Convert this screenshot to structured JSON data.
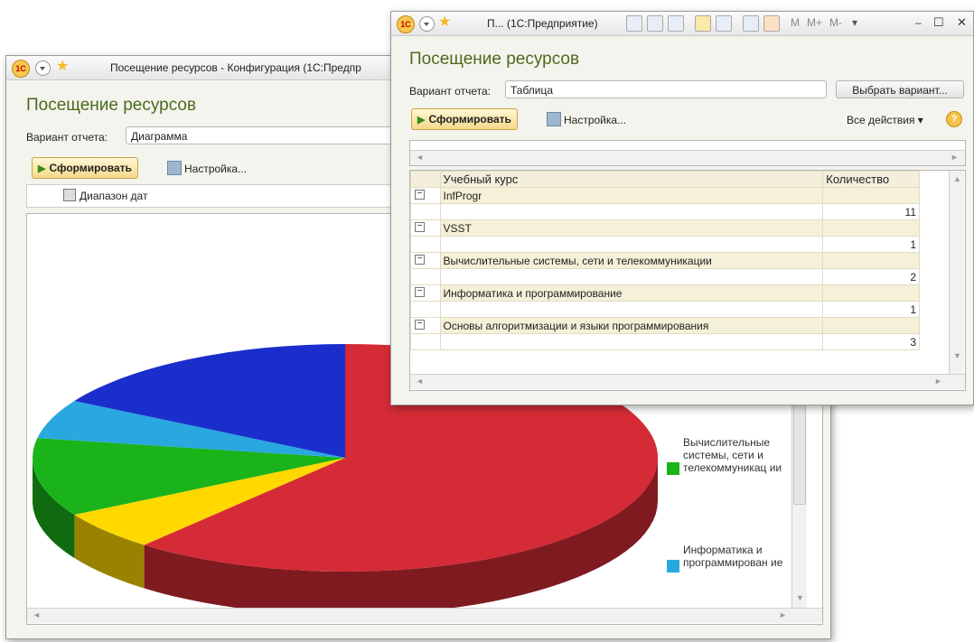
{
  "back_window": {
    "title": "Посещение ресурсов - Конфигурация  (1С:Предпр",
    "form_title": "Посещение ресурсов",
    "variant_label": "Вариант отчета:",
    "variant_value": "Диаграмма",
    "generate_label": "Сформировать",
    "settings_label": "Настройка...",
    "filter_label": "Диапазон дат",
    "legend": [
      {
        "label": "Вычислительные системы, сети и телекоммуникац ии",
        "color": "#1ab31a"
      },
      {
        "label": "Информатика и программирован ие",
        "color": "#29a8e0"
      }
    ]
  },
  "chart_data": {
    "type": "pie",
    "categories": [
      "InfProgr",
      "VSST",
      "Вычислительные системы, сети и телекоммуникации",
      "Информатика и программирование",
      "Основы алгоритмизации и языки программирования"
    ],
    "values": [
      11,
      1,
      2,
      1,
      3
    ],
    "colors": [
      "#d42b36",
      "#ffd800",
      "#1ab31a",
      "#29a8e0",
      "#1a2ecc"
    ],
    "style": "3d"
  },
  "front_window": {
    "title": "П...  (1С:Предприятие)",
    "memory_buttons": [
      "M",
      "M+",
      "M-"
    ],
    "form_title": "Посещение ресурсов",
    "variant_label": "Вариант отчета:",
    "variant_value": "Таблица",
    "choose_variant": "Выбрать вариант...",
    "generate_label": "Сформировать",
    "settings_label": "Настройка...",
    "all_actions": "Все действия",
    "table": {
      "columns": [
        "Учебный курс",
        "Количество"
      ],
      "groups": [
        {
          "name": "InfProgr",
          "value": "11"
        },
        {
          "name": "VSST",
          "value": "1"
        },
        {
          "name": "Вычислительные системы, сети и телекоммуникации",
          "value": "2"
        },
        {
          "name": "Информатика и программирование",
          "value": "1"
        },
        {
          "name": "Основы алгоритмизации и языки программирования",
          "value": "3"
        }
      ]
    }
  }
}
